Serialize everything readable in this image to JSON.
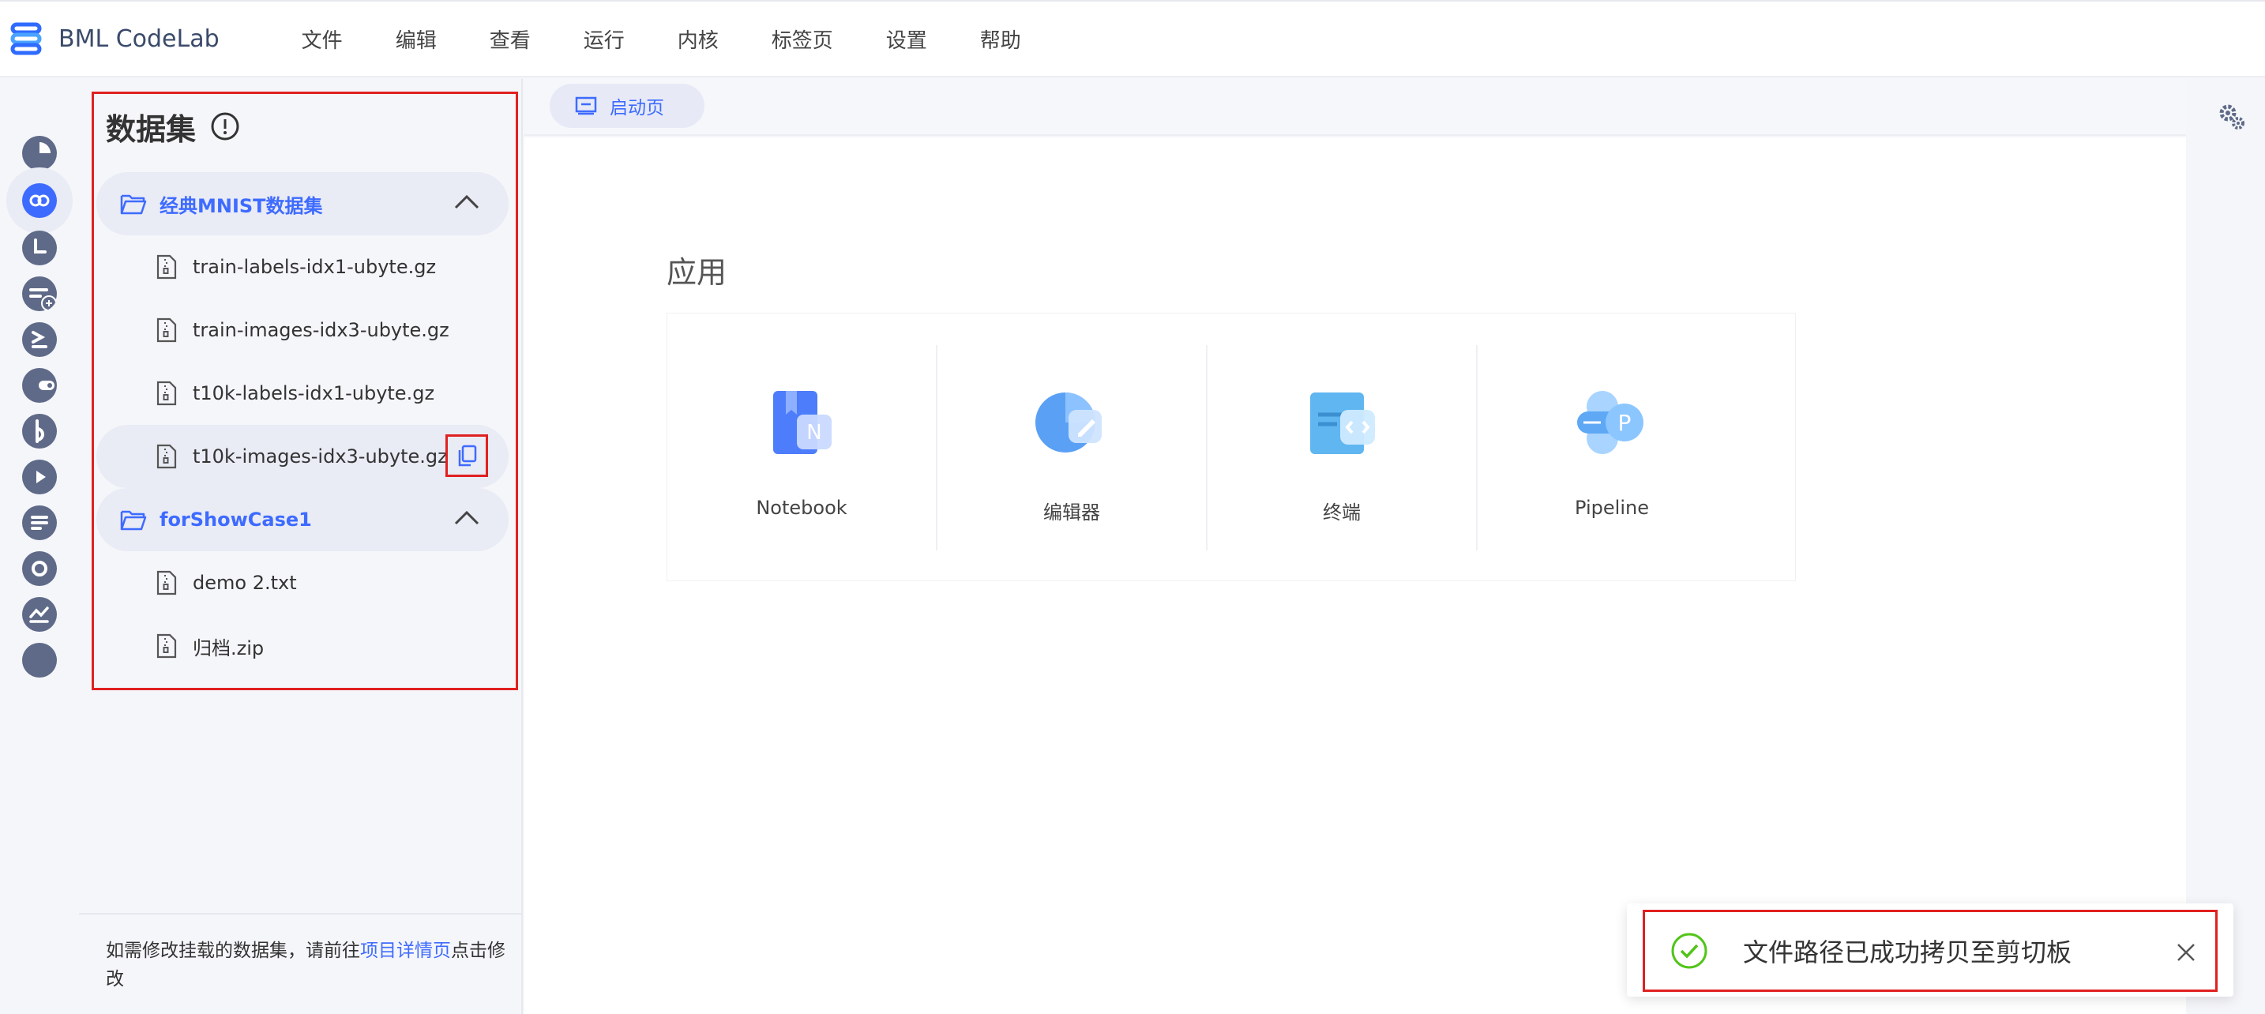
{
  "app": {
    "title": "BML CodeLab"
  },
  "menu": [
    "文件",
    "编辑",
    "查看",
    "运行",
    "内核",
    "标签页",
    "设置",
    "帮助"
  ],
  "colors": {
    "accent": "#3e6bff",
    "highlight_box": "#e02020",
    "success": "#52c41a"
  },
  "rail_icons": [
    "pie-chart-icon",
    "dataset-icon",
    "clock-icon",
    "list-add-icon",
    "terminal-icon",
    "toggle-icon",
    "plugin-icon",
    "play-icon",
    "document-icon",
    "circle-icon",
    "trend-icon"
  ],
  "panel": {
    "title": "数据集",
    "folders": [
      {
        "name": "经典MNIST数据集",
        "files": [
          "train-labels-idx1-ubyte.gz",
          "train-images-idx3-ubyte.gz",
          "t10k-labels-idx1-ubyte.gz",
          "t10k-images-idx3-ubyte.gz"
        ]
      },
      {
        "name": "forShowCase1",
        "files": [
          "demo 2.txt",
          "归档.zip"
        ]
      }
    ],
    "footer_text_before": "如需修改挂载的数据集，请前往",
    "footer_link": "项目详情页",
    "footer_text_after": "点击修改"
  },
  "tab": {
    "label": "启动页"
  },
  "launcher": {
    "section_title": "应用",
    "apps": [
      {
        "label": "Notebook",
        "icon": "notebook-icon"
      },
      {
        "label": "编辑器",
        "icon": "editor-icon"
      },
      {
        "label": "终端",
        "icon": "terminal-app-icon"
      },
      {
        "label": "Pipeline",
        "icon": "pipeline-icon"
      }
    ]
  },
  "toast": {
    "message": "文件路径已成功拷贝至剪切板"
  }
}
